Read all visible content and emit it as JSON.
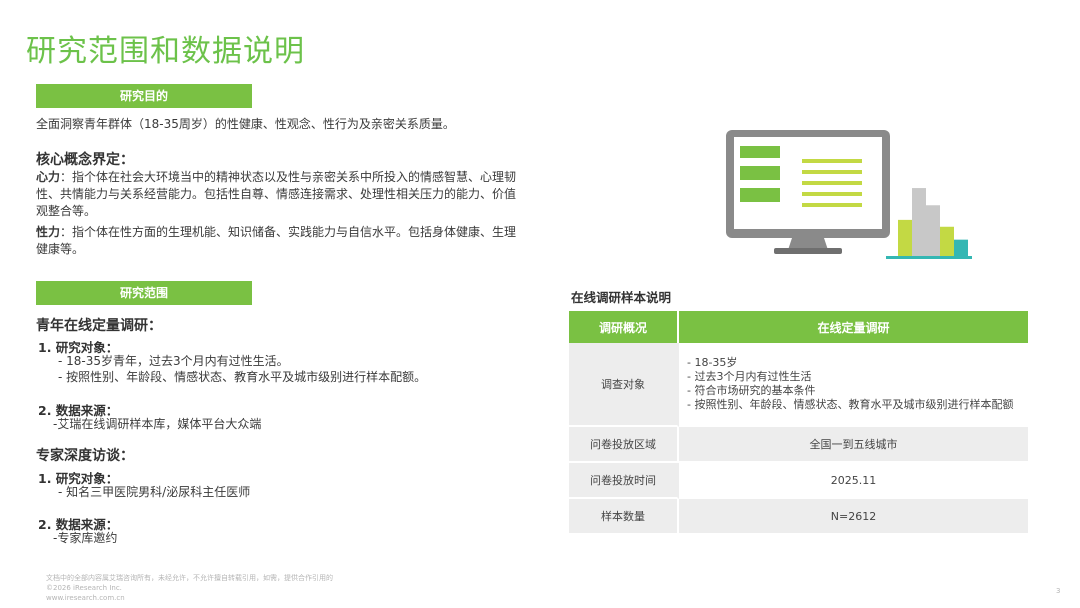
{
  "title": "研究范围和数据说明",
  "purpose": {
    "label": "研究目的",
    "text": "全面洞察青年群体（18-35周岁）的性健康、性观念、性行为及亲密关系质量。"
  },
  "concepts": {
    "heading": "核心概念界定：",
    "xinli_term": "心力",
    "xinli_text": "：指个体在社会大环境当中的精神状态以及性与亲密关系中所投入的情感智慧、心理韧性、共情能力与关系经营能力。包括性自尊、情感连接需求、处理性相关压力的能力、价值观整合等。",
    "xingli_term": "性力",
    "xingli_text": "：指个体在性方面的生理机能、知识储备、实践能力与自信水平。包括身体健康、生理健康等。"
  },
  "scope": {
    "label": "研究范围",
    "online_heading": "青年在线定量调研：",
    "online_obj_title": "1.  研究对象：",
    "online_obj_items": [
      "- 18-35岁青年，过去3个月内有过性生活。",
      "- 按照性别、年龄段、情感状态、教育水平及城市级别进行样本配额。"
    ],
    "online_src_title": "2. 数据来源：",
    "online_src_text": "-艾瑞在线调研样本库，媒体平台大众端",
    "expert_heading": "专家深度访谈：",
    "expert_obj_title": "1.  研究对象：",
    "expert_obj_text": "- 知名三甲医院男科/泌尿科主任医师",
    "expert_src_title": "2. 数据来源：",
    "expert_src_text": "-专家库邀约"
  },
  "sample_table": {
    "caption": "在线调研样本说明",
    "col1": "调研概况",
    "col2": "在线定量调研",
    "rows": {
      "target_label": "调查对象",
      "target_items": [
        "- 18-35岁",
        "- 过去3个月内有过性生活",
        "- 符合市场研究的基本条件",
        "- 按照性别、年龄段、情感状态、教育水平及城市级别进行样本配额"
      ],
      "region_label": "问卷投放区域",
      "region_value": "全国一到五线城市",
      "time_label": "问卷投放时间",
      "time_value": "2025.11",
      "count_label": "样本数量",
      "count_value": "N=2612"
    }
  },
  "footer": {
    "line1": "文档中的全部内容属艾瑞咨询所有，未经允许，不允许擅自转载引用，如需，提供合作引用的",
    "line2": "©2026 iResearch Inc.",
    "line3": "www.iresearch.com.cn",
    "page": "3"
  },
  "colors": {
    "accent": "#7ac143",
    "title": "#6cc24a",
    "monitor": "#8a8a8a",
    "bar_gray": "#c8c8c8",
    "bar_lime": "#c3d944",
    "bar_teal": "#34b7b3"
  },
  "illustration": {
    "icon": "monitor-with-bar-chart-icon",
    "bar_levels": [
      0.42,
      0.79,
      0.59,
      0.34,
      0.19
    ]
  }
}
